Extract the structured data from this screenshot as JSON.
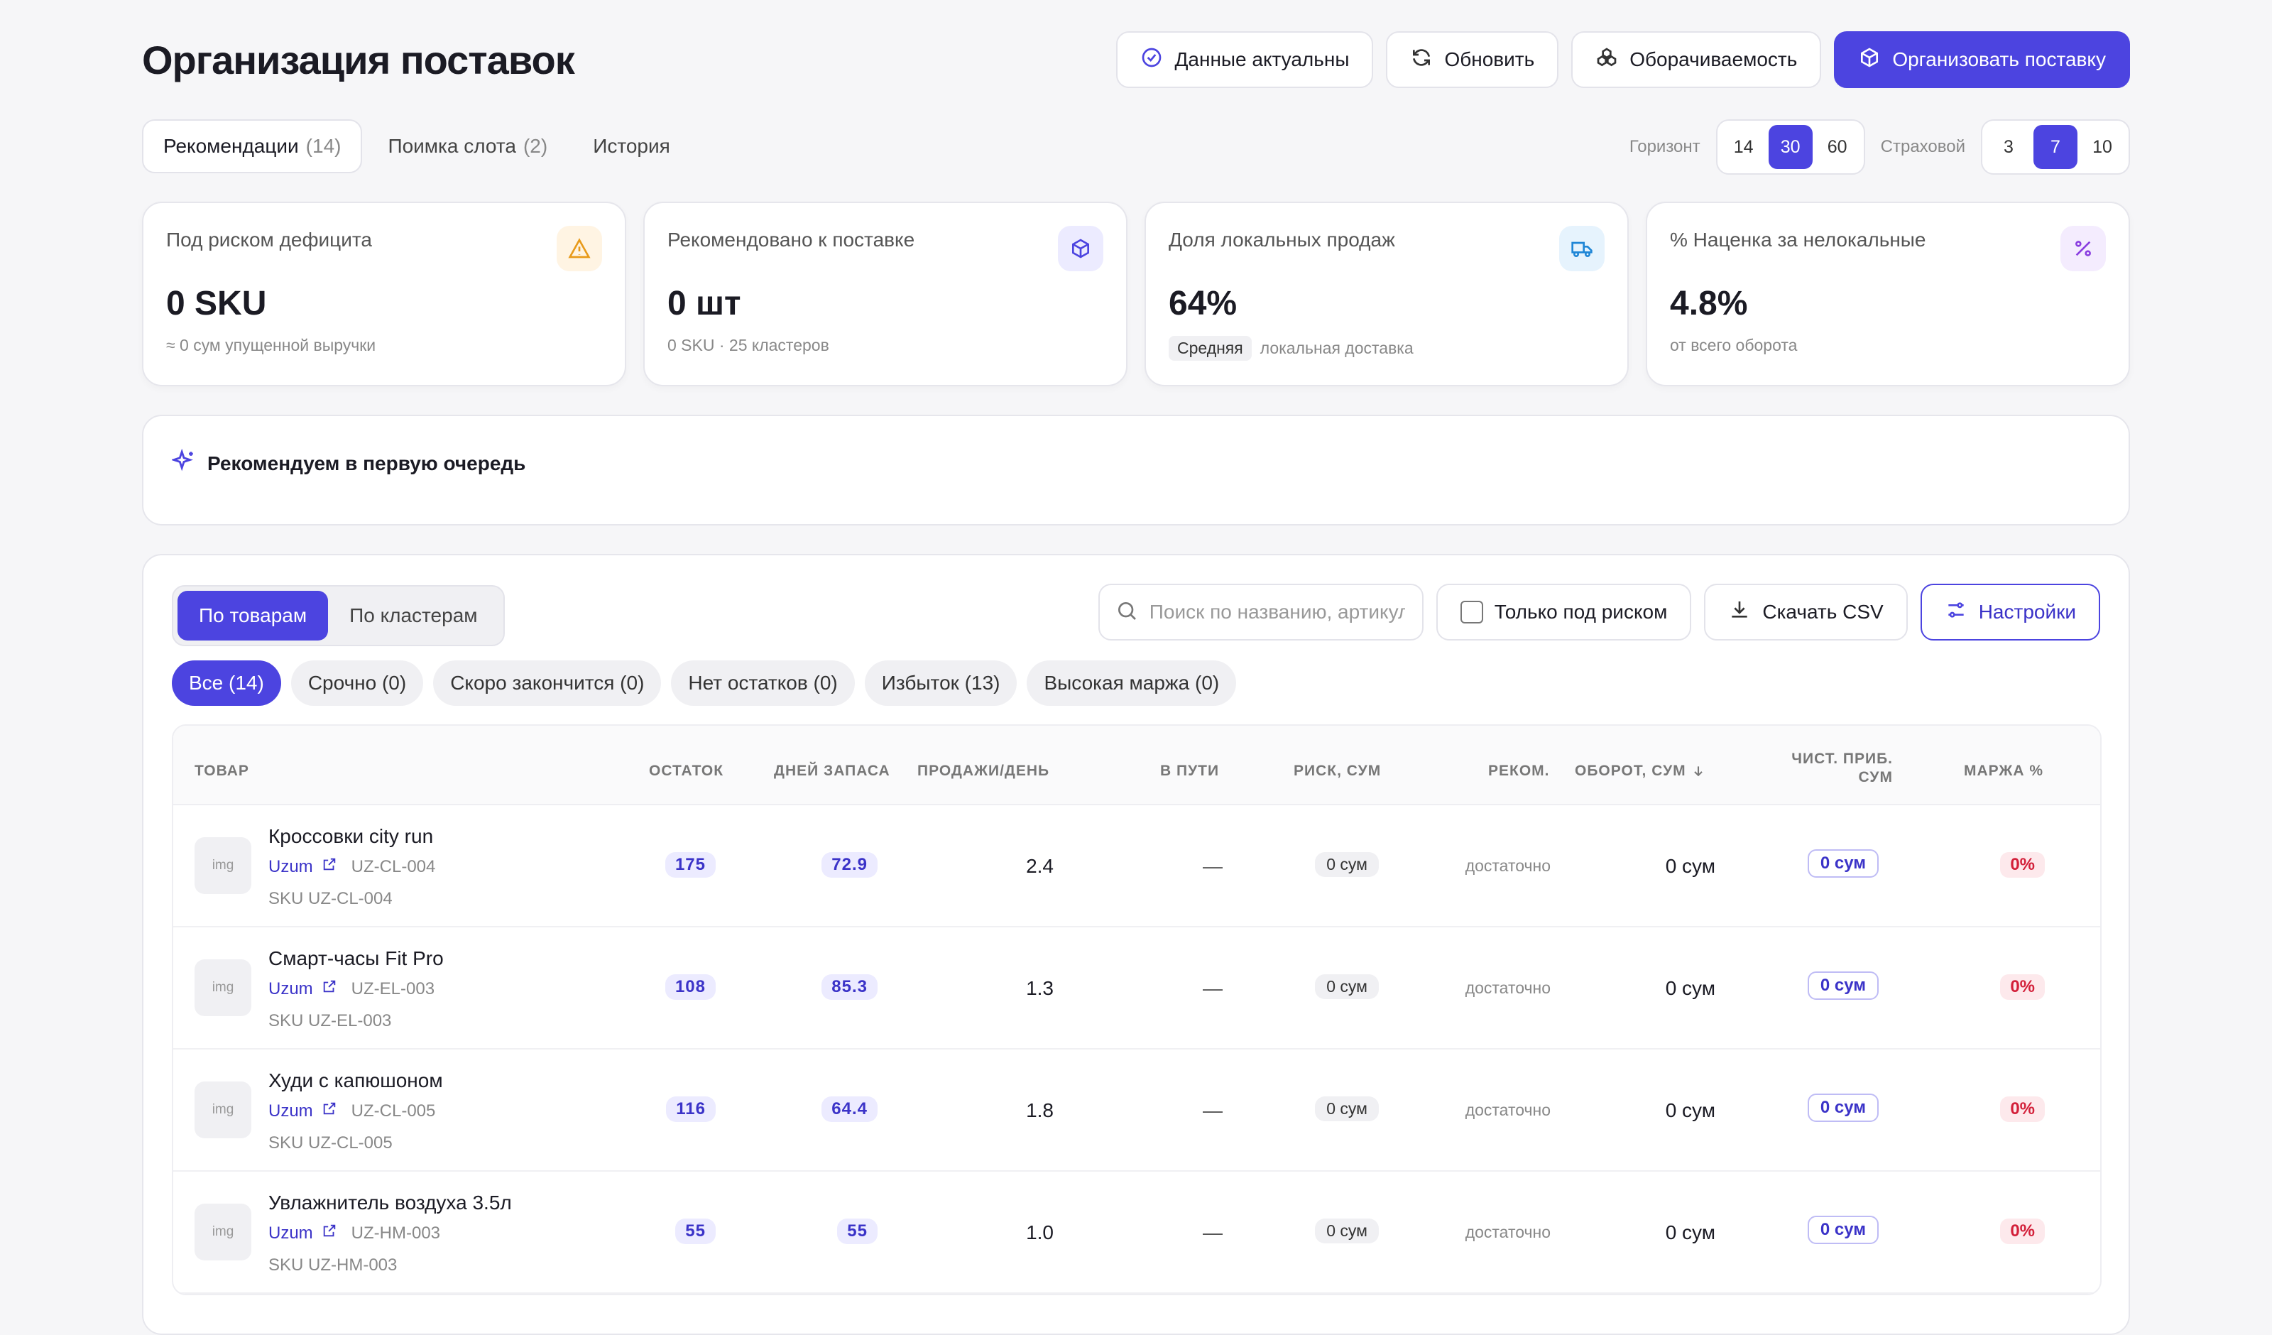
{
  "header": {
    "title": "Организация поставок",
    "status_label": "Данные актуальны",
    "refresh_label": "Обновить",
    "turnover_label": "Оборачиваемость",
    "organize_label": "Организовать поставку"
  },
  "tabs": [
    {
      "label": "Рекомендации",
      "count": "(14)"
    },
    {
      "label": "Поимка слота",
      "count": "(2)"
    },
    {
      "label": "История",
      "count": ""
    }
  ],
  "horizon": {
    "label": "Горизонт",
    "options": [
      "14",
      "30",
      "60"
    ],
    "selected": "30"
  },
  "safety": {
    "label": "Страховой",
    "options": [
      "3",
      "7",
      "10"
    ],
    "selected": "7"
  },
  "cards": [
    {
      "label": "Под риском дефицита",
      "value": "0 SKU",
      "sub": "≈ 0 сум упущенной выручки",
      "icon": "warning-icon"
    },
    {
      "label": "Рекомендовано к поставке",
      "value": "0 шт",
      "sub": "0 SKU · 25 кластеров",
      "icon": "box-icon"
    },
    {
      "label": "Доля локальных продаж",
      "value": "64%",
      "badge": "Средняя",
      "sub": "локальная доставка",
      "icon": "truck-icon"
    },
    {
      "label": "% Наценка за нелокальные",
      "value": "4.8%",
      "sub": "от всего оборота",
      "icon": "percent-icon"
    }
  ],
  "recommend": {
    "title": "Рекомендуем в первую очередь"
  },
  "toolbar": {
    "view_options": [
      "По товарам",
      "По кластерам"
    ],
    "view_selected": "По товарам",
    "search_placeholder": "Поиск по названию, артикулу",
    "risk_only_label": "Только под риском",
    "csv_label": "Скачать CSV",
    "settings_label": "Настройки"
  },
  "filters": [
    {
      "label": "Все (14)",
      "active": true
    },
    {
      "label": "Срочно (0)",
      "active": false
    },
    {
      "label": "Скоро закончится (0)",
      "active": false
    },
    {
      "label": "Нет остатков (0)",
      "active": false
    },
    {
      "label": "Избыток (13)",
      "active": false
    },
    {
      "label": "Высокая маржа (0)",
      "active": false
    }
  ],
  "table": {
    "columns": {
      "product": "ТОВАР",
      "stock": "ОСТАТОК",
      "days": "ДНЕЙ ЗАПАСА",
      "sales": "ПРОДАЖИ/ДЕНЬ",
      "transit": "В ПУТИ",
      "risk": "РИСК, СУМ",
      "recom": "РЕКОМ.",
      "turnover": "ОБОРОТ, СУМ",
      "profit_line1": "ЧИСТ. ПРИБ.",
      "profit_line2": "СУМ",
      "margin": "МАРЖА %"
    },
    "img_placeholder": "img",
    "rows": [
      {
        "name": "Кроссовки city run",
        "marketplace": "Uzum",
        "code": "UZ-CL-004",
        "sku": "SKU UZ-CL-004",
        "stock": "175",
        "days": "72.9",
        "sales": "2.4",
        "transit": "—",
        "risk": "0 сум",
        "recom": "достаточно",
        "turnover": "0 сум",
        "profit": "0 сум",
        "margin": "0%"
      },
      {
        "name": "Смарт-часы Fit Pro",
        "marketplace": "Uzum",
        "code": "UZ-EL-003",
        "sku": "SKU UZ-EL-003",
        "stock": "108",
        "days": "85.3",
        "sales": "1.3",
        "transit": "—",
        "risk": "0 сум",
        "recom": "достаточно",
        "turnover": "0 сум",
        "profit": "0 сум",
        "margin": "0%"
      },
      {
        "name": "Худи с капюшоном",
        "marketplace": "Uzum",
        "code": "UZ-CL-005",
        "sku": "SKU UZ-CL-005",
        "stock": "116",
        "days": "64.4",
        "sales": "1.8",
        "transit": "—",
        "risk": "0 сум",
        "recom": "достаточно",
        "turnover": "0 сум",
        "profit": "0 сум",
        "margin": "0%"
      },
      {
        "name": "Увлажнитель воздуха 3.5л",
        "marketplace": "Uzum",
        "code": "UZ-HM-003",
        "sku": "SKU UZ-HM-003",
        "stock": "55",
        "days": "55",
        "sales": "1.0",
        "transit": "—",
        "risk": "0 сум",
        "recom": "достаточно",
        "turnover": "0 сум",
        "profit": "0 сум",
        "margin": "0%"
      }
    ]
  },
  "colors": {
    "accent": "#4c44e0",
    "danger": "#d3203a",
    "warning": "#e89a1a"
  }
}
